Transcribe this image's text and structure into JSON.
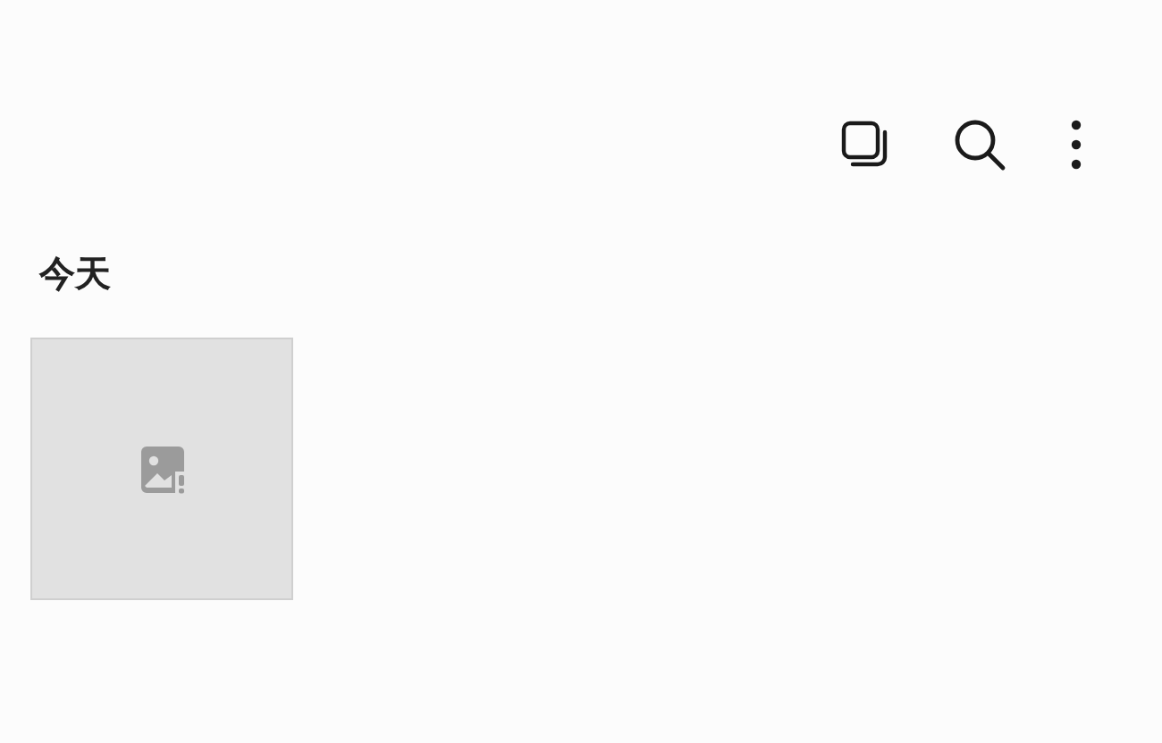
{
  "section": {
    "title": "今天"
  },
  "items": [
    {
      "kind": "broken_image"
    }
  ]
}
